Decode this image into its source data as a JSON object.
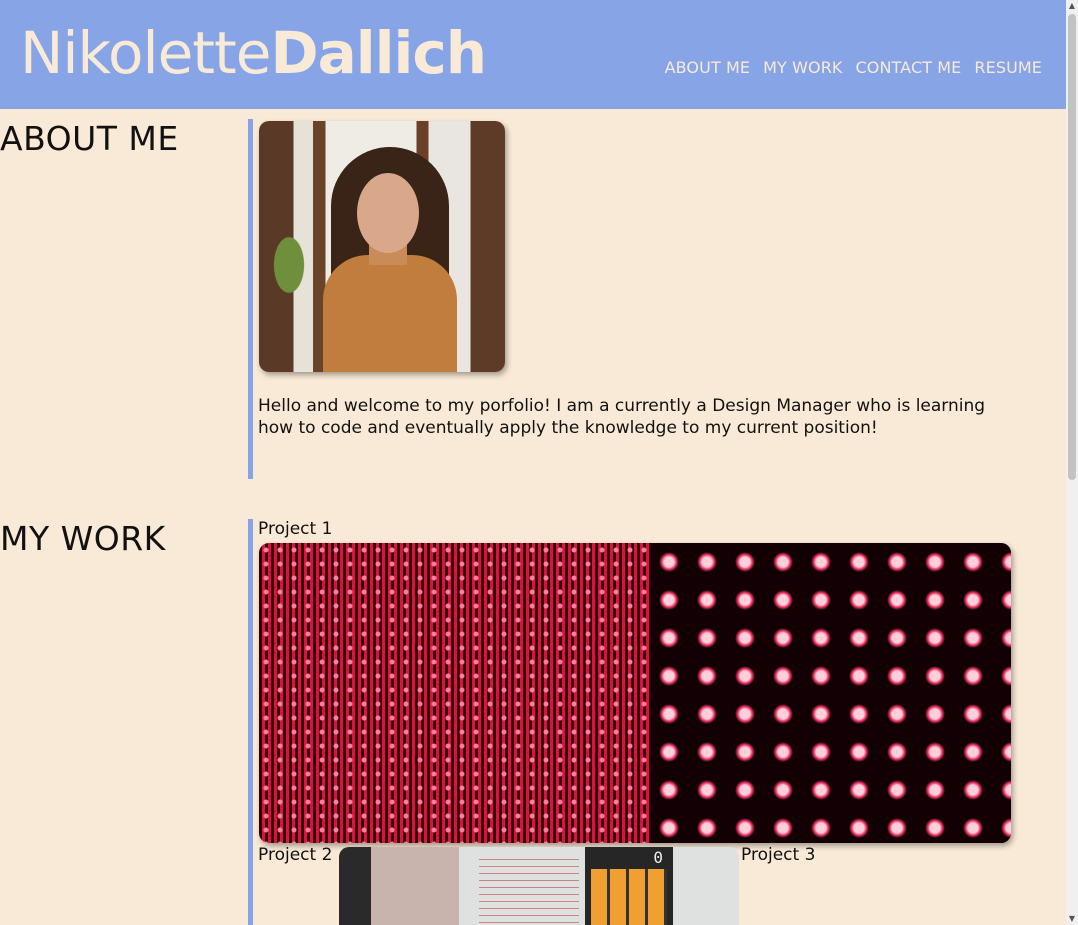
{
  "header": {
    "first_name": "Nikolette",
    "last_name": "Dallich",
    "nav": [
      "ABOUT ME",
      "MY WORK",
      "CONTACT ME",
      "RESUME"
    ]
  },
  "about": {
    "title": "ABOUT ME",
    "intro": "Hello and welcome to my porfolio! I am a currently a Design Manager who is learning how to code and eventually apply the knowledge to my current position!"
  },
  "work": {
    "title": "MY WORK",
    "projects": [
      "Project 1",
      "Project 2",
      "Project 3"
    ],
    "calculator_display": "0"
  },
  "colors": {
    "header_bg": "#87A5E6",
    "page_bg": "#F9EAD7",
    "accent_rule": "#87A5E6"
  }
}
